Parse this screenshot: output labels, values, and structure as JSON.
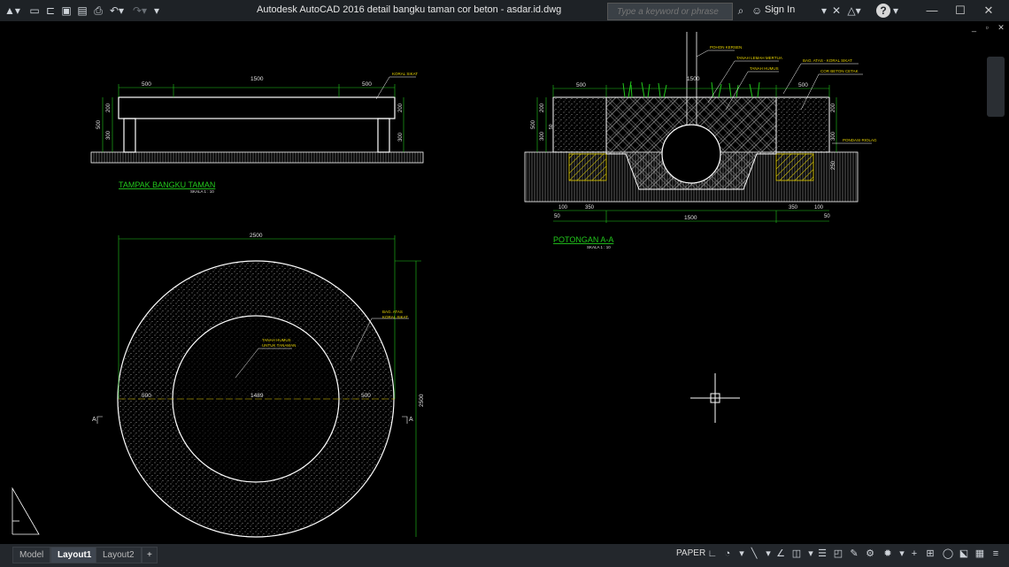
{
  "titlebar": {
    "title": "Autodesk AutoCAD 2016      detail bangku taman cor beton - asdar.id.dwg",
    "search_placeholder": "Type a keyword or phrase",
    "signin": "Sign In",
    "app_menu_icon": "autocad-logo-icon",
    "colors": {
      "bg": "#1e2226"
    }
  },
  "drawing": {
    "front_view": {
      "dims": {
        "left": "500",
        "mid": "1500",
        "right": "500",
        "h1": "200",
        "h2": "300",
        "h3": "500",
        "hr1": "200",
        "hr2": "300"
      },
      "note": "KORAL SIKAT",
      "title": "TAMPAK BANGKU TAMAN",
      "scale": "SKALA 1 : 10"
    },
    "section": {
      "labels": {
        "pohon": "POHON KERSEN",
        "tanah_merah": "TANAH LEMAH MERTUA",
        "tanah_humus": "TANAH HUMUS",
        "bag_atas": "BAG. ATAS - KORAL SIKAT",
        "cor_beton": "COR BETON CETAK",
        "pondasi": "PONDASI RIOLAG"
      },
      "dims": {
        "top_left": "500",
        "top_right": "500",
        "top_mid": "1500",
        "h200": "200",
        "h300": "300",
        "h500": "500",
        "h50": "50",
        "r300": "300",
        "r200": "200",
        "r250": "250",
        "b100": "100",
        "b350": "350",
        "b1500": "1500",
        "b350r": "350",
        "b100r": "100",
        "b50": "50",
        "b50r": "50"
      },
      "title": "POTONGAN A-A",
      "scale": "SKALA 1 : 10"
    },
    "plan": {
      "dims": {
        "top": "2500",
        "left": "500",
        "mid": "1489",
        "right": "500",
        "vert": "2500"
      },
      "label_center": [
        "TANAH HUMUS",
        "UNTUK TANAMAN"
      ],
      "label_ring": [
        "BAG. ATAS",
        "KORAL SIKAT"
      ],
      "section_marks": [
        "A",
        "A"
      ]
    }
  },
  "tabs": [
    {
      "label": "Model"
    },
    {
      "label": "Layout1"
    },
    {
      "label": "Layout2"
    },
    {
      "label": "+"
    }
  ],
  "statusbar": {
    "paper": "PAPER"
  },
  "colors": {
    "dim": "#22c81c",
    "annotation": "#e6d200",
    "line": "#ffffff"
  }
}
